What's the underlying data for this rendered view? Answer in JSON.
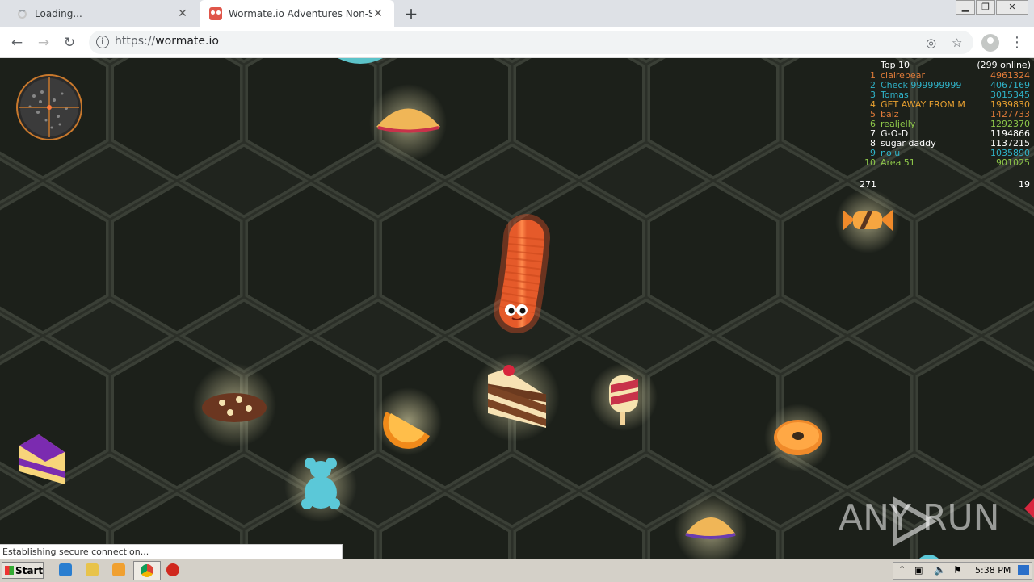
{
  "browser": {
    "tabs": [
      {
        "title": "Loading...",
        "state": "loading"
      },
      {
        "title": "Wormate.io Adventures Non-Stop",
        "state": "active"
      }
    ],
    "url_scheme": "https://",
    "url_host": "wormate.io",
    "status_text": "Establishing secure connection..."
  },
  "game": {
    "leaderboard": {
      "title": "Top 10",
      "online": "(299 online)",
      "rows": [
        {
          "rank": "1",
          "name": "clairebear",
          "score": "4961324",
          "color": "#e07b39"
        },
        {
          "rank": "2",
          "name": "Check 999999999",
          "score": "4067169",
          "color": "#2fb3c9"
        },
        {
          "rank": "3",
          "name": "Tomas",
          "score": "3015345",
          "color": "#2fb3c9"
        },
        {
          "rank": "4",
          "name": "GET AWAY FROM M",
          "score": "1939830",
          "color": "#e8a030"
        },
        {
          "rank": "5",
          "name": "balz",
          "score": "1427733",
          "color": "#e07b39"
        },
        {
          "rank": "6",
          "name": "realjelly",
          "score": "1292370",
          "color": "#8fc94a"
        },
        {
          "rank": "7",
          "name": "G-O-D",
          "score": "1194866",
          "color": "#ffffff"
        },
        {
          "rank": "8",
          "name": "sugar daddy",
          "score": "1137215",
          "color": "#ffffff"
        },
        {
          "rank": "9",
          "name": "no u",
          "score": "1035890",
          "color": "#2fb3c9"
        },
        {
          "rank": "10",
          "name": "Area 51",
          "score": "901025",
          "color": "#8fc94a"
        }
      ],
      "my_score": "271",
      "my_rank": "19"
    },
    "watermark": "ANY RUN"
  },
  "taskbar": {
    "start_label": "Start",
    "clock": "5:38 PM"
  }
}
